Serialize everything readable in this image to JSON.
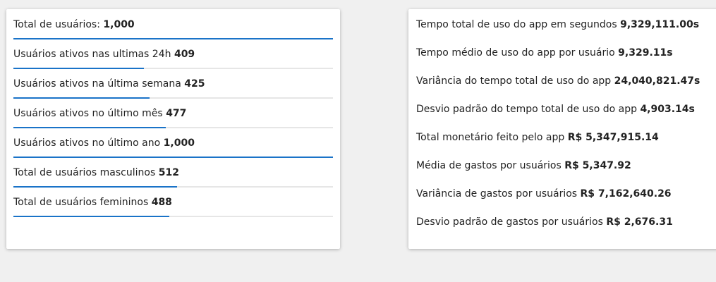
{
  "users_card": {
    "metrics": [
      {
        "label": "Total de usuários:",
        "value": "1,000",
        "progress": 1.0
      },
      {
        "label": "Usuários ativos nas ultimas 24h",
        "value": "409",
        "progress": 0.409
      },
      {
        "label": "Usuários ativos na última semana",
        "value": "425",
        "progress": 0.425
      },
      {
        "label": "Usuários ativos no último mês",
        "value": "477",
        "progress": 0.477
      },
      {
        "label": "Usuários ativos no último ano",
        "value": "1,000",
        "progress": 1.0
      },
      {
        "label": "Total de usuários masculinos",
        "value": "512",
        "progress": 0.512
      },
      {
        "label": "Total de usuários femininos",
        "value": "488",
        "progress": 0.488
      }
    ]
  },
  "stats_card": {
    "items": [
      {
        "label": "Tempo total de uso do app em segundos",
        "value": "9,329,111.00s"
      },
      {
        "label": "Tempo médio de uso do app por usuário",
        "value": "9,329.11s"
      },
      {
        "label": "Variância do tempo total de uso do app",
        "value": "24,040,821.47s"
      },
      {
        "label": "Desvio padrão do tempo total de uso do app",
        "value": "4,903.14s"
      },
      {
        "label": "Total monetário feito pelo app",
        "value": "R$ 5,347,915.14"
      },
      {
        "label": "Média de gastos por usuários",
        "value": "R$ 5,347.92"
      },
      {
        "label": "Variância de gastos por usuários",
        "value": "R$ 7,162,640.26"
      },
      {
        "label": "Desvio padrão de gastos por usuários",
        "value": "R$ 2,676.31"
      }
    ]
  },
  "colors": {
    "accent": "#1a73c8",
    "track": "#e6e6e6",
    "background": "#f0f0f0",
    "card": "#ffffff"
  }
}
